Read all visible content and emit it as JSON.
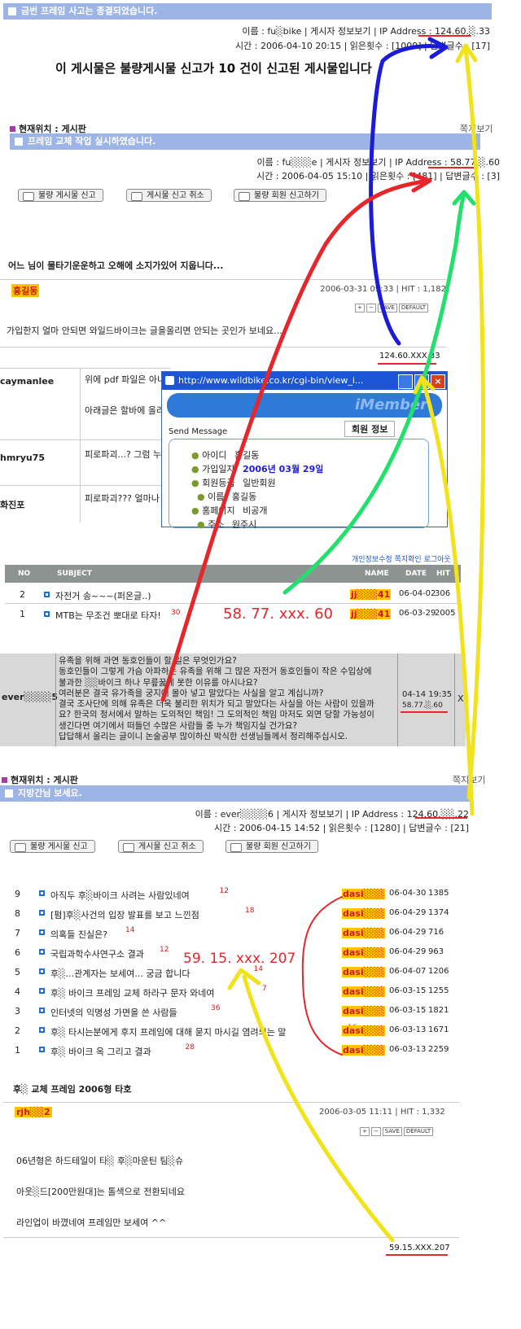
{
  "post1": {
    "title": "금번 프레임 사고는 종결되었습니다.",
    "meta_line1": "이름 : fu░bike | 게시자 정보보기 | IP Address : 124.60.░.33",
    "meta_line2": "시간 : 2006-04-10 20:15 | 읽은횟수 : [1009] | 답변글수 : [17]"
  },
  "notice": "이 게시물은 불량게시물 신고가 10 건이 신고된 게시물입니다",
  "post2": {
    "location_label": "현재위치 : 게시판",
    "right_link": "쪽지보기",
    "title": "프레임 교체 작업 실시하였습니다.",
    "meta_line1": "이름 : fu░░░e | 게시자 정보보기 | IP Address : 58.77.░.60",
    "meta_line2": "시간 : 2006-04-05 15:10 | 읽은횟수 : [481] | 답변글수 : [3]",
    "buttons": [
      "불량 게시물 신고",
      "게시물 신고 취소",
      "불량 회원 신고하기"
    ],
    "body": "어느 님이 물타기운운하고 오해에 소지가있어 지웁니다..."
  },
  "comment1": {
    "author": "홍길동",
    "date_hit": "2006-03-31 09:33 | HIT : 1,182",
    "mini_buttons": [
      "+",
      "−",
      "SAVE",
      "DEFAULT"
    ],
    "body": "가입한지 얼마 안되면 와일드바이크는 글을올리면 안되는 곳인가 보네요...",
    "ip": "124.60.XXX.33"
  },
  "replies": [
    {
      "author": "caymanlee",
      "text1": "위에 pdf 파일은 아니",
      "text2": "아래글은 할바에 올라"
    },
    {
      "author": "hmryu75",
      "text1": "피로파괴...? 그럼 누",
      "text2": ""
    },
    {
      "author": "화진포",
      "text1": "피로파괴??? 얼마나",
      "text2": ""
    }
  ],
  "popup": {
    "title": "http://www.wildbike.co.kr/cgi-bin/view_i...",
    "banner": "iMember",
    "header": "회원 정보",
    "send_message": "Send Message",
    "rows": [
      {
        "label": "아이디",
        "value": "홍길동"
      },
      {
        "label": "가입일자",
        "value": "2006년 03월 29일"
      },
      {
        "label": "회원등급",
        "value": "일반회원"
      },
      {
        "label": "이름",
        "value": "홍길동"
      },
      {
        "label": "홈페이지",
        "value": "비공개"
      },
      {
        "label": "주소",
        "value": "원주시"
      }
    ]
  },
  "top_links": [
    "개인정보수정",
    "쪽지확인",
    "로그아웃"
  ],
  "table1": {
    "headers": [
      "NO",
      "SUBJECT",
      "NAME",
      "DATE",
      "HIT"
    ],
    "rows": [
      {
        "no": "2",
        "subject": "자전거 송~~~(퍼온글..)",
        "name": "jj░░░41",
        "date": "06-04-02",
        "hit": "306",
        "comments": ""
      },
      {
        "no": "1",
        "subject": "MTB는 무조건 뽀대로 타자!",
        "name": "jj░░░41",
        "date": "06-03-29",
        "hit": "2005",
        "comments": "30"
      }
    ]
  },
  "annot_ip_58": "58. 77. xxx. 60",
  "comment_block": {
    "author": "ever░░░░5",
    "text": "유족을 위해 과연 동호인들이 할 일은 무엇인가요?\n동호인들이 그렇게 가슴 아파하는 유족을 위해 그 많은 자전거 동호인들이 작은 수입상에\n불과한 ░░바이크 하나 무릎꿇게 못한 이유를 아시나요?\n여러분은 결국 유가족을 궁지에 몰아 넣고 말았다는 사실을 알고 계십니까?\n결국 조사단에 의해 유족은 더욱 불리한 위치가 되고 말았다는 사실을 아는 사람이 있을까\n요? 한국의 정서에서 말하는 도의적인 책임! 그 도의적인 책임 마저도 외면 당할 가능성이\n생긴다면 여기에서 떠들던 수많은 사람들 중 누가 책임지실 건가요?\n답답해서 올리는 글이니 논술공부 많이하신 박식한 선생님들께서 정리해주십시오.",
    "date": "04-14 19:35",
    "ip": "58.77.░.60",
    "close": "X"
  },
  "post3": {
    "location_label": "현재위치 : 게시판",
    "right_link": "쪽지보기",
    "title": "지방간님 보세요.",
    "meta_line1": "이름 : ever░░░░6 | 게시자 정보보기 | IP Address : 124.60.░░.22",
    "meta_line2": "시간 : 2006-04-15 14:52 | 읽은횟수 : [1280] | 답변글수 : [21]",
    "buttons": [
      "불량 게시물 신고",
      "게시물 신고 취소",
      "불량 회원 신고하기"
    ]
  },
  "table2": {
    "rows": [
      {
        "no": "9",
        "subject": "아직두 후░바이크 사려는 사람있네여",
        "comments": "12",
        "name": "dasi░░░",
        "date": "06-04-30",
        "hit": "1385"
      },
      {
        "no": "8",
        "subject": "[펌]후░사건의 입장 발표를 보고 느낀점",
        "comments": "18",
        "name": "dasi░░░",
        "date": "06-04-29",
        "hit": "1374"
      },
      {
        "no": "7",
        "subject": "의혹들 진실은?",
        "comments": "14",
        "name": "dasi░░░",
        "date": "06-04-29",
        "hit": "716"
      },
      {
        "no": "6",
        "subject": "국립과학수사연구소 결과",
        "comments": "12",
        "name": "dasi░░░",
        "date": "06-04-29",
        "hit": "963"
      },
      {
        "no": "5",
        "subject": "후░...관계자는 보세여... 궁금 합니다",
        "comments": "14",
        "name": "dasi░░░",
        "date": "06-04-07",
        "hit": "1206"
      },
      {
        "no": "4",
        "subject": "후░ 바이크 프레임 교체 하라구 문자 와네여",
        "comments": "7",
        "name": "dasi░░░",
        "date": "06-03-15",
        "hit": "1255"
      },
      {
        "no": "3",
        "subject": "인터넷의 익명성 가면을 쓴 사람들",
        "comments": "36",
        "name": "dasi░░░",
        "date": "06-03-15",
        "hit": "1821"
      },
      {
        "no": "2",
        "subject": "후░ 타시는분에게 후지 프레임에 대해 묻지 마시길 염려되는 말",
        "comments": "16",
        "name": "dasi░░░",
        "date": "06-03-13",
        "hit": "1671"
      },
      {
        "no": "1",
        "subject": "후░ 바이크 옥 그리고 결과",
        "comments": "28",
        "name": "dasi░░░",
        "date": "06-03-13",
        "hit": "2259"
      }
    ]
  },
  "annot_ip_59": "59. 15. xxx. 207",
  "post4": {
    "title": "후░ 교체 프레임 2006형 타호",
    "author": "rjh░░2",
    "date_hit": "2006-03-05 11:11 | HIT : 1,332",
    "mini_buttons": [
      "+",
      "−",
      "SAVE",
      "DEFAULT"
    ],
    "lines": [
      "06년형은 하드테일이 타░ 후░마운틴 팀░슈",
      "아웃░드[200만원대]는 톨색으로 전환되네요",
      "라인업이 바꼈네여 프레임만 보세여 ^^"
    ],
    "ip": "59.15.XXX.207"
  },
  "colors": {
    "titlebar": "#9db4e6",
    "annot_red": "#e5262b",
    "annot_blue": "#1c1cd8",
    "annot_green": "#22e06b",
    "annot_yellow": "#f2e21b"
  }
}
